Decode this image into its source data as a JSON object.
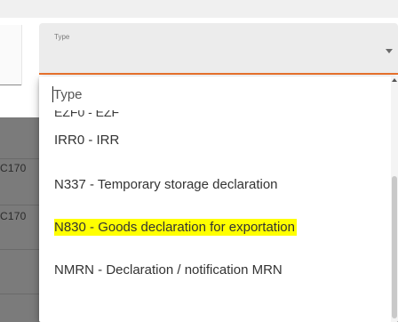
{
  "field": {
    "label": "Type"
  },
  "dropdown": {
    "filter_placeholder": "Type",
    "partial_item": "EZF0 - EZF",
    "options": [
      {
        "label": "IRR0 - IRR",
        "highlighted": false
      },
      {
        "label": "N337 - Temporary storage declaration",
        "highlighted": false
      },
      {
        "label": "N830 - Goods declaration for exportation",
        "highlighted": true
      },
      {
        "label": "NMRN - Declaration / notification MRN",
        "highlighted": false
      }
    ]
  },
  "background": {
    "row_1_text": "C170",
    "row_2_text": "C170"
  },
  "colors": {
    "accent_underline": "#e8712c",
    "highlight": "#ffff00"
  }
}
